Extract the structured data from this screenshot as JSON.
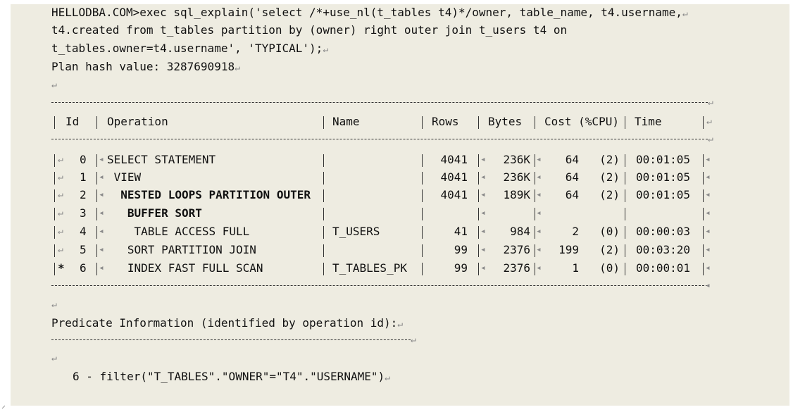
{
  "header": {
    "line1": "HELLODBA.COM>exec sql_explain('select /*+use_nl(t_tables t4)*/owner, table_name, t4.username,",
    "line2": "t4.created from t_tables partition by (owner) right outer join t_users t4 on",
    "line3": "t_tables.owner=t4.username', 'TYPICAL');",
    "plan_hash": "Plan hash value: 3287690918"
  },
  "return_mark": "↵",
  "cell_mark": "◂",
  "table": {
    "columns": [
      "Id",
      "Operation",
      "Name",
      "Rows",
      "Bytes",
      "Cost (%CPU)",
      "Time"
    ],
    "rows": [
      {
        "flag": "",
        "id": "0",
        "op": "SELECT STATEMENT",
        "name": "",
        "rows": "4041",
        "bytes": "236K",
        "cost": "64",
        "cpu": "(2)",
        "time": "00:01:05",
        "bold": false
      },
      {
        "flag": "",
        "id": "1",
        "op": " VIEW",
        "name": "",
        "rows": "4041",
        "bytes": "236K",
        "cost": "64",
        "cpu": "(2)",
        "time": "00:01:05",
        "bold": false
      },
      {
        "flag": "",
        "id": "2",
        "op": "  NESTED LOOPS PARTITION OUTER",
        "name": "",
        "rows": "4041",
        "bytes": "189K",
        "cost": "64",
        "cpu": "(2)",
        "time": "00:01:05",
        "bold": true
      },
      {
        "flag": "",
        "id": "3",
        "op": "   BUFFER SORT",
        "name": "",
        "rows": "",
        "bytes": "",
        "cost": "",
        "cpu": "",
        "time": "",
        "bold": true
      },
      {
        "flag": "",
        "id": "4",
        "op": "    TABLE ACCESS FULL",
        "name": "T_USERS",
        "rows": "41",
        "bytes": "984",
        "cost": "2",
        "cpu": "(0)",
        "time": "00:00:03",
        "bold": false
      },
      {
        "flag": "",
        "id": "5",
        "op": "   SORT PARTITION JOIN",
        "name": "",
        "rows": "99",
        "bytes": "2376",
        "cost": "199",
        "cpu": "(2)",
        "time": "00:03:20",
        "bold": false
      },
      {
        "flag": "*",
        "id": "6",
        "op": "   INDEX FAST FULL SCAN",
        "name": "T_TABLES_PK",
        "rows": "99",
        "bytes": "2376",
        "cost": "1",
        "cpu": "(0)",
        "time": "00:00:01",
        "bold": false
      }
    ]
  },
  "predicate": {
    "title": "Predicate Information (identified by operation id):",
    "filter": "6 - filter(\"T_TABLES\".\"OWNER\"=\"T4\".\"USERNAME\")"
  }
}
